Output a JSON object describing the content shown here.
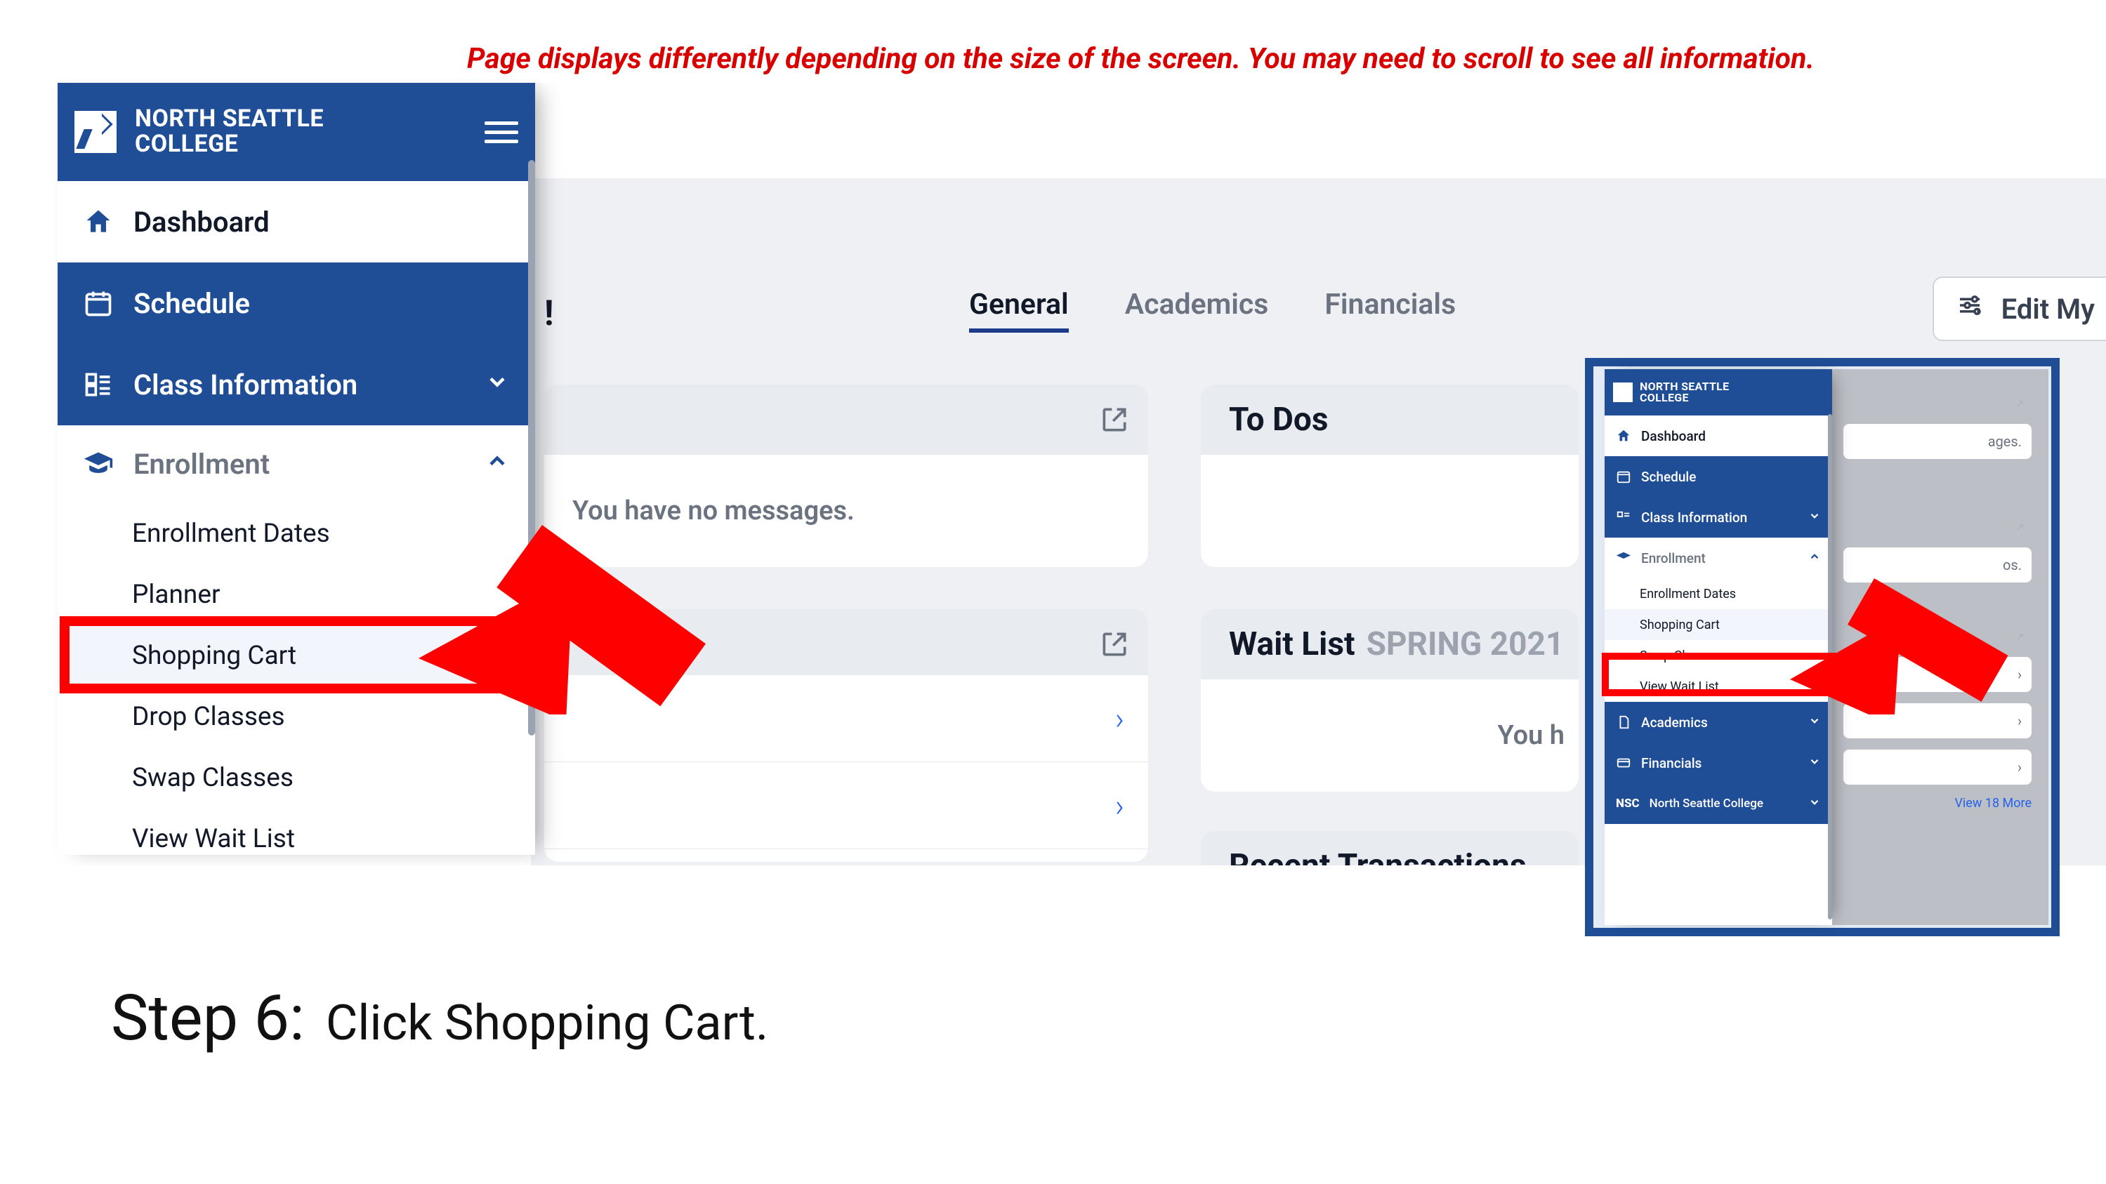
{
  "note": "Page displays differently depending on the size of the screen. You may need to scroll to see all information.",
  "brand": {
    "line1": "NORTH SEATTLE",
    "line2": "COLLEGE"
  },
  "sidebar": {
    "dashboard": "Dashboard",
    "schedule": "Schedule",
    "classInfo": "Class Information",
    "enrollment": "Enrollment",
    "subs": {
      "enrollmentDates": "Enrollment Dates",
      "planner": "Planner",
      "shoppingCart": "Shopping Cart",
      "dropClasses": "Drop Classes",
      "swapClasses": "Swap Classes",
      "viewWaitList": "View Wait List"
    }
  },
  "workspace": {
    "exclaim": "!",
    "tabs": {
      "general": "General",
      "academics": "Academics",
      "financials": "Financials"
    },
    "editMy": "Edit My",
    "noMessages": "You have no messages.",
    "todos": "To Dos",
    "waitlist": {
      "title": "Wait List",
      "term": "SPRING 2021",
      "youh": "You h"
    },
    "recent": "Recent Transactions",
    "chevron": "›"
  },
  "inset": {
    "msgs": "ages.",
    "os": "os.",
    "viewMore": "View 18 More",
    "academics": "Academics",
    "financials": "Financials",
    "campusSelectorLabel": "NSC",
    "campusSelectorValue": "North Seattle College"
  },
  "caption": {
    "step": "Step 6:",
    "desc": "Click Shopping Cart."
  }
}
